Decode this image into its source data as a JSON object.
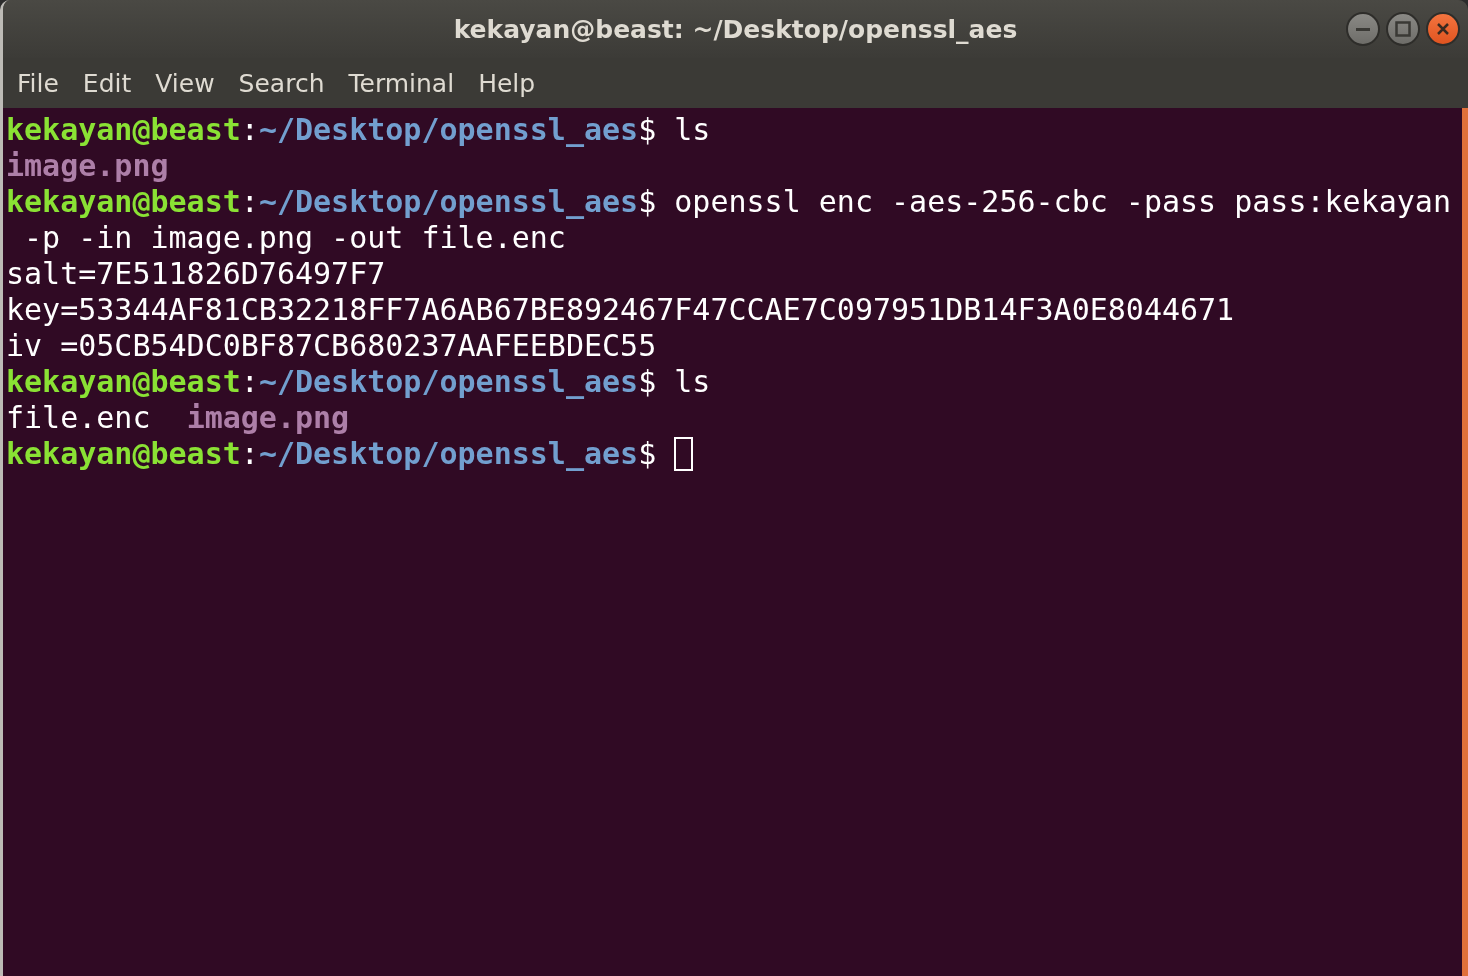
{
  "window": {
    "title": "kekayan@beast: ~/Desktop/openssl_aes"
  },
  "menu": [
    "File",
    "Edit",
    "View",
    "Search",
    "Terminal",
    "Help"
  ],
  "terminal": {
    "lines": [
      {
        "segments": [
          {
            "kind": "user",
            "text": "kekayan@beast"
          },
          {
            "kind": "plain",
            "text": ":"
          },
          {
            "kind": "path",
            "text": "~/Desktop/openssl_aes"
          },
          {
            "kind": "plain",
            "text": "$ ls"
          }
        ]
      },
      {
        "segments": [
          {
            "kind": "image",
            "text": "image.png"
          }
        ]
      },
      {
        "segments": [
          {
            "kind": "user",
            "text": "kekayan@beast"
          },
          {
            "kind": "plain",
            "text": ":"
          },
          {
            "kind": "path",
            "text": "~/Desktop/openssl_aes"
          },
          {
            "kind": "plain",
            "text": "$ openssl enc -aes-256-cbc -pass pass:kekayan"
          }
        ]
      },
      {
        "segments": [
          {
            "kind": "plain",
            "text": " -p -in image.png -out file.enc"
          }
        ]
      },
      {
        "segments": [
          {
            "kind": "plain",
            "text": "salt=7E511826D76497F7"
          }
        ]
      },
      {
        "segments": [
          {
            "kind": "plain",
            "text": "key=53344AF81CB32218FF7A6AB67BE892467F47CCAE7C097951DB14F3A0E8044671"
          }
        ]
      },
      {
        "segments": [
          {
            "kind": "plain",
            "text": "iv =05CB54DC0BF87CB680237AAFEEBDEC55"
          }
        ]
      },
      {
        "segments": [
          {
            "kind": "user",
            "text": "kekayan@beast"
          },
          {
            "kind": "plain",
            "text": ":"
          },
          {
            "kind": "path",
            "text": "~/Desktop/openssl_aes"
          },
          {
            "kind": "plain",
            "text": "$ ls"
          }
        ]
      },
      {
        "segments": [
          {
            "kind": "plain",
            "text": "file.enc  "
          },
          {
            "kind": "image",
            "text": "image.png"
          }
        ]
      },
      {
        "segments": [
          {
            "kind": "user",
            "text": "kekayan@beast"
          },
          {
            "kind": "plain",
            "text": ":"
          },
          {
            "kind": "path",
            "text": "~/Desktop/openssl_aes"
          },
          {
            "kind": "plain",
            "text": "$ "
          }
        ],
        "cursor": true
      }
    ]
  }
}
